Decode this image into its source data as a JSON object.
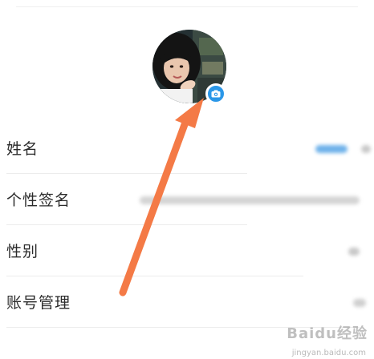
{
  "profile": {
    "avatar_alt": "用户头像",
    "camera_badge_icon": "camera-icon"
  },
  "rows": [
    {
      "label": "姓名"
    },
    {
      "label": "个性签名"
    },
    {
      "label": "性别"
    },
    {
      "label": "账号管理"
    }
  ],
  "annotation": {
    "arrow_color": "#f47a46",
    "icon": "arrow-up-right-annotation"
  },
  "watermark": {
    "logo": "Baidu经验",
    "url": "jingyan.baidu.com"
  },
  "colors": {
    "accent_blue": "#2a97e8",
    "label_text": "#2b2b2b",
    "divider": "#ececec"
  }
}
